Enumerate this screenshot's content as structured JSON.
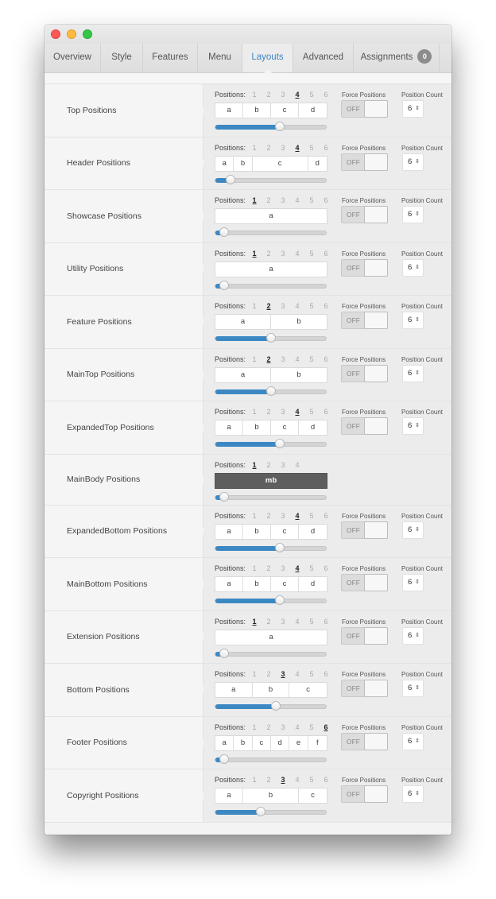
{
  "window": {
    "controls": [
      "close",
      "minimize",
      "zoom"
    ]
  },
  "tabs": [
    {
      "label": "Overview",
      "active": false
    },
    {
      "label": "Style",
      "active": false
    },
    {
      "label": "Features",
      "active": false
    },
    {
      "label": "Menu",
      "active": false
    },
    {
      "label": "Layouts",
      "active": true
    },
    {
      "label": "Advanced",
      "active": false
    },
    {
      "label": "Assignments",
      "active": false,
      "badge": "0"
    }
  ],
  "colors": {
    "accent": "#3b88c3",
    "active_tab_text": "#3d86c6",
    "mainbody_cell": "#5e5e5e"
  },
  "labels": {
    "positions": "Positions:",
    "force_positions": "Force Positions",
    "position_count": "Position Count",
    "toggle_off": "OFF"
  },
  "rows": [
    {
      "name": "Top Positions",
      "options": [
        "1",
        "2",
        "3",
        "4",
        "5",
        "6"
      ],
      "selected": "4",
      "cells": [
        {
          "label": "a",
          "span": 3
        },
        {
          "label": "b",
          "span": 3
        },
        {
          "label": "c",
          "span": 3
        },
        {
          "label": "d",
          "span": 3
        }
      ],
      "slider": 0.58,
      "force": "OFF",
      "count": "6"
    },
    {
      "name": "Header Positions",
      "options": [
        "1",
        "2",
        "3",
        "4",
        "5",
        "6"
      ],
      "selected": "4",
      "cells": [
        {
          "label": "a",
          "span": 2
        },
        {
          "label": "b",
          "span": 2
        },
        {
          "label": "c",
          "span": 6
        },
        {
          "label": "d",
          "span": 2
        }
      ],
      "slider": 0.14,
      "force": "OFF",
      "count": "6"
    },
    {
      "name": "Showcase Positions",
      "options": [
        "1",
        "2",
        "3",
        "4",
        "5",
        "6"
      ],
      "selected": "1",
      "cells": [
        {
          "label": "a",
          "span": 12
        }
      ],
      "slider": 0.08,
      "force": "OFF",
      "count": "6"
    },
    {
      "name": "Utility Positions",
      "options": [
        "1",
        "2",
        "3",
        "4",
        "5",
        "6"
      ],
      "selected": "1",
      "cells": [
        {
          "label": "a",
          "span": 12
        }
      ],
      "slider": 0.08,
      "force": "OFF",
      "count": "6"
    },
    {
      "name": "Feature Positions",
      "options": [
        "1",
        "2",
        "3",
        "4",
        "5",
        "6"
      ],
      "selected": "2",
      "cells": [
        {
          "label": "a",
          "span": 6
        },
        {
          "label": "b",
          "span": 6
        }
      ],
      "slider": 0.5,
      "force": "OFF",
      "count": "6"
    },
    {
      "name": "MainTop Positions",
      "options": [
        "1",
        "2",
        "3",
        "4",
        "5",
        "6"
      ],
      "selected": "2",
      "cells": [
        {
          "label": "a",
          "span": 6
        },
        {
          "label": "b",
          "span": 6
        }
      ],
      "slider": 0.5,
      "force": "OFF",
      "count": "6"
    },
    {
      "name": "ExpandedTop Positions",
      "options": [
        "1",
        "2",
        "3",
        "4",
        "5",
        "6"
      ],
      "selected": "4",
      "cells": [
        {
          "label": "a",
          "span": 3
        },
        {
          "label": "b",
          "span": 3
        },
        {
          "label": "c",
          "span": 3
        },
        {
          "label": "d",
          "span": 3
        }
      ],
      "slider": 0.58,
      "force": "OFF",
      "count": "6"
    },
    {
      "name": "MainBody Positions",
      "options": [
        "1",
        "2",
        "3",
        "4"
      ],
      "selected": "1",
      "cells": [
        {
          "label": "mb",
          "span": 12
        }
      ],
      "slider": 0.08,
      "dark": true,
      "short": true
    },
    {
      "name": "ExpandedBottom Positions",
      "options": [
        "1",
        "2",
        "3",
        "4",
        "5",
        "6"
      ],
      "selected": "4",
      "cells": [
        {
          "label": "a",
          "span": 3
        },
        {
          "label": "b",
          "span": 3
        },
        {
          "label": "c",
          "span": 3
        },
        {
          "label": "d",
          "span": 3
        }
      ],
      "slider": 0.58,
      "force": "OFF",
      "count": "6"
    },
    {
      "name": "MainBottom Positions",
      "options": [
        "1",
        "2",
        "3",
        "4",
        "5",
        "6"
      ],
      "selected": "4",
      "cells": [
        {
          "label": "a",
          "span": 3
        },
        {
          "label": "b",
          "span": 3
        },
        {
          "label": "c",
          "span": 3
        },
        {
          "label": "d",
          "span": 3
        }
      ],
      "slider": 0.58,
      "force": "OFF",
      "count": "6"
    },
    {
      "name": "Extension Positions",
      "options": [
        "1",
        "2",
        "3",
        "4",
        "5",
        "6"
      ],
      "selected": "1",
      "cells": [
        {
          "label": "a",
          "span": 12
        }
      ],
      "slider": 0.08,
      "force": "OFF",
      "count": "6"
    },
    {
      "name": "Bottom Positions",
      "options": [
        "1",
        "2",
        "3",
        "4",
        "5",
        "6"
      ],
      "selected": "3",
      "cells": [
        {
          "label": "a",
          "span": 4
        },
        {
          "label": "b",
          "span": 4
        },
        {
          "label": "c",
          "span": 4
        }
      ],
      "slider": 0.55,
      "force": "OFF",
      "count": "6"
    },
    {
      "name": "Footer Positions",
      "options": [
        "1",
        "2",
        "3",
        "4",
        "5",
        "6"
      ],
      "selected": "6",
      "cells": [
        {
          "label": "a",
          "span": 2
        },
        {
          "label": "b",
          "span": 2
        },
        {
          "label": "c",
          "span": 2
        },
        {
          "label": "d",
          "span": 2
        },
        {
          "label": "e",
          "span": 2
        },
        {
          "label": "f",
          "span": 2
        }
      ],
      "slider": 0.08,
      "force": "OFF",
      "count": "6"
    },
    {
      "name": "Copyright Positions",
      "options": [
        "1",
        "2",
        "3",
        "4",
        "5",
        "6"
      ],
      "selected": "3",
      "cells": [
        {
          "label": "a",
          "span": 3
        },
        {
          "label": "b",
          "span": 6
        },
        {
          "label": "c",
          "span": 3
        }
      ],
      "slider": 0.41,
      "force": "OFF",
      "count": "6"
    }
  ]
}
